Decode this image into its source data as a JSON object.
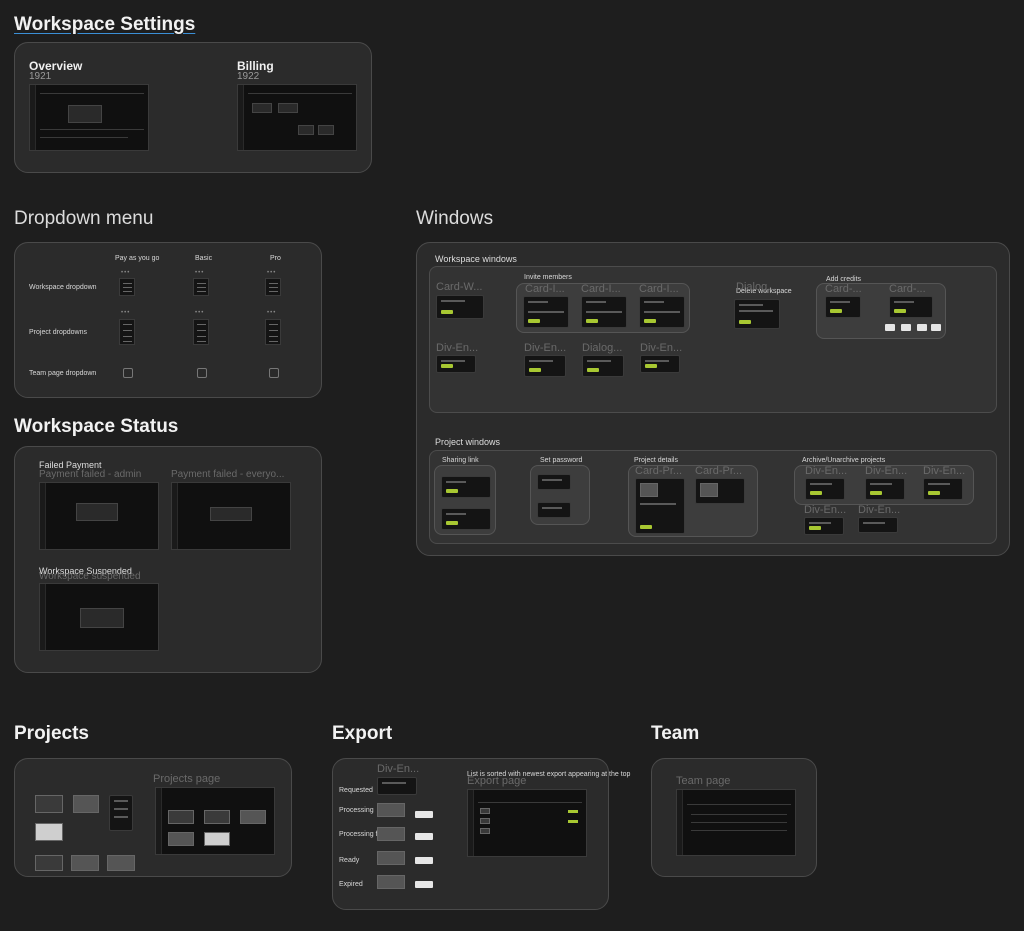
{
  "sections": {
    "workspace_settings": "Workspace Settings",
    "dropdown_menu": "Dropdown menu",
    "windows": "Windows",
    "workspace_status": "Workspace Status",
    "projects": "Projects",
    "export": "Export",
    "team": "Team"
  },
  "workspace_settings": {
    "overview": {
      "title": "Overview",
      "number": "1921"
    },
    "billing": {
      "title": "Billing",
      "number": "1922"
    }
  },
  "dropdown_menu": {
    "columns": [
      "Pay as you go",
      "Basic",
      "Pro"
    ],
    "rows": [
      "Workspace dropdown",
      "Project dropdowns",
      "Team page dropdown"
    ]
  },
  "windows": {
    "workspace_windows": {
      "title": "Workspace windows",
      "ghosts": [
        "Card-W...",
        "Card-I...",
        "Card-I...",
        "Card-I...",
        "Dialog...",
        "Card-...",
        "Card-...",
        "Div-En...",
        "Div-En...",
        "Dialog...",
        "Div-En..."
      ],
      "labels": {
        "invite": "Invite members",
        "delete": "Delete workspace",
        "credits": "Add credits",
        "create": "Create workspace"
      }
    },
    "project_windows": {
      "title": "Project windows",
      "labels": {
        "sharing": "Sharing link",
        "password": "Set password",
        "details": "Project details",
        "archive": "Archive/Unarchive projects"
      },
      "ghosts": [
        "Card-Pr...",
        "Card-Pr...",
        "Div-En...",
        "Div-En...",
        "Div-En...",
        "Div-En...",
        "Div-En..."
      ]
    }
  },
  "workspace_status": {
    "failed_payment": "Failed Payment",
    "ghost_admin": "Payment failed - admin",
    "ghost_everyone": "Payment failed - everyo...",
    "suspended": "Workspace Suspended",
    "ghost_suspended": "Workspace suspended"
  },
  "projects": {
    "ghost": "Projects page"
  },
  "export": {
    "ghost_div": "Div-En...",
    "ghost_page": "Export page",
    "note": "List is sorted with newest export appearing at the top",
    "states": [
      "Requested",
      "Processing",
      "Processing failed",
      "Ready",
      "Expired"
    ]
  },
  "team": {
    "ghost": "Team page"
  },
  "colors": {
    "background": "#1e1e1e",
    "panel": "#2b2b2b",
    "accent": "#a8c832",
    "underline": "#3b8fd6"
  }
}
